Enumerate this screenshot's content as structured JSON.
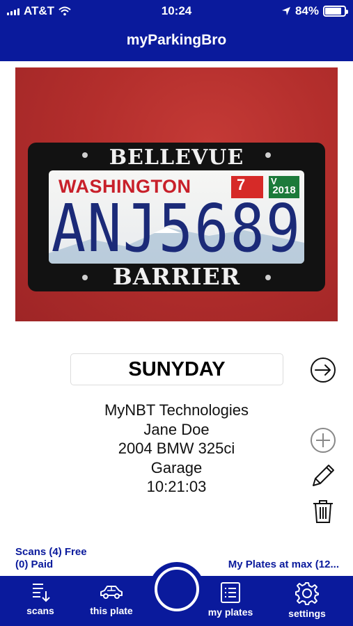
{
  "status_bar": {
    "carrier": "AT&T",
    "time": "10:24",
    "battery": "84%",
    "battery_level": 0.84
  },
  "header": {
    "title": "myParkingBro"
  },
  "photo": {
    "frame_top": "BELLEVUE",
    "frame_bottom": "BARRIER",
    "state": "WASHINGTON",
    "tab_month": "7",
    "tab_year": "2018",
    "tab_year_letter": "V",
    "plate_number": "ANJ5689"
  },
  "plate_name": "SUNYDAY",
  "info": {
    "company": "MyNBT Technologies",
    "owner": "Jane Doe",
    "vehicle": "2004 BMW 325ci",
    "location": "Garage",
    "time": "10:21:03"
  },
  "footer": {
    "scans_free": "Scans (4) Free",
    "scans_paid": "(0) Paid",
    "plates_max": "My Plates at max (12..."
  },
  "tabs": [
    {
      "label": "scans",
      "icon": "scans-list-icon"
    },
    {
      "label": "this plate",
      "icon": "car-icon"
    },
    {
      "label": "my plates",
      "icon": "plates-list-icon"
    },
    {
      "label": "settings",
      "icon": "gear-icon"
    }
  ],
  "colors": {
    "brand": "#0a1a9c",
    "background": "#ffffff"
  }
}
